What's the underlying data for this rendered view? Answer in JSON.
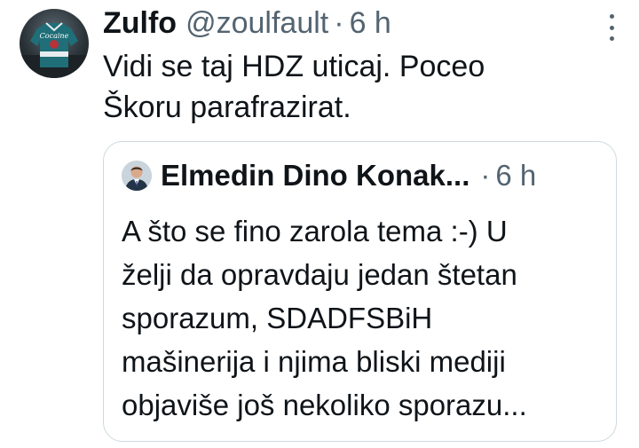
{
  "tweet": {
    "author_name": "Zulfo",
    "author_handle": "@zoulfault",
    "separator": "·",
    "time": "6 h",
    "text_line1": "Vidi se taj HDZ uticaj. Poceo",
    "text_line2": "Škoru parafrazirat.",
    "avatar_icon": "hockey-jersey-avatar-icon",
    "avatar_logo_text": "Cocaine",
    "more_icon": "more-vertical-icon"
  },
  "quoted_tweet": {
    "author_name": "Elmedin Dino Konak...",
    "separator": "·",
    "time": "6 h",
    "avatar_icon": "person-in-suit-avatar-icon",
    "text_line1": "A što se fino zarola tema :-) U",
    "text_line2": "želji da opravdaju jedan štetan",
    "text_line3": "sporazum, SDADFSBiH",
    "text_line4": "mašinerija i njima bliski mediji",
    "text_line5": "objaviše još nekoliko sporazu..."
  },
  "colors": {
    "text_primary": "#0f1419",
    "text_secondary": "#536471",
    "border": "#cfd9de",
    "background": "#ffffff"
  }
}
